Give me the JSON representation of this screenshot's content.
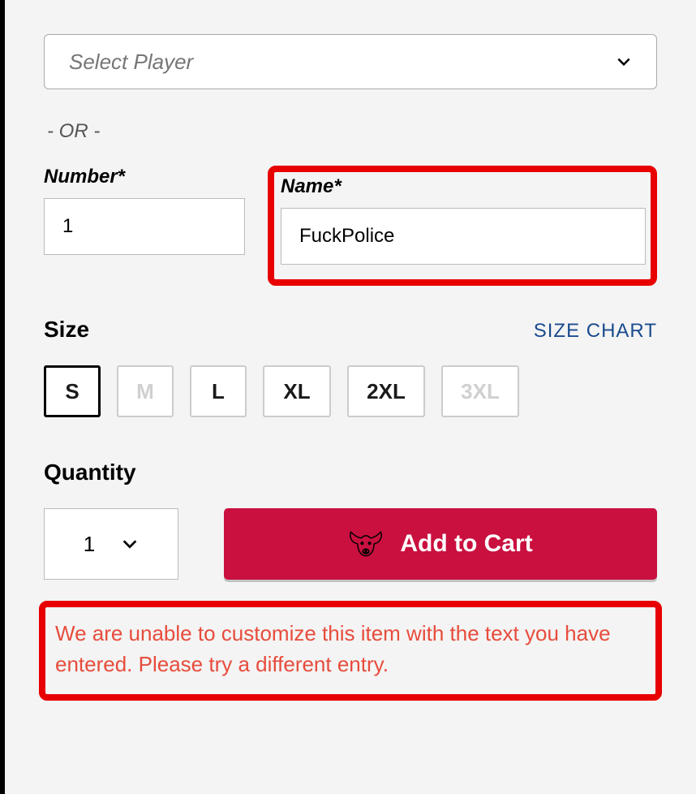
{
  "player_select": {
    "placeholder": "Select Player"
  },
  "divider": "- OR -",
  "number": {
    "label": "Number*",
    "value": "1"
  },
  "name": {
    "label": "Name*",
    "value": "FuckPolice"
  },
  "size": {
    "label": "Size",
    "chart_link": "SIZE CHART",
    "options": {
      "s": "S",
      "m": "M",
      "l": "L",
      "xl": "XL",
      "xxl": "2XL",
      "xxxl": "3XL"
    }
  },
  "quantity": {
    "label": "Quantity",
    "value": "1"
  },
  "add_to_cart_label": "Add to Cart",
  "error_message": "We are unable to customize this item with the text you have entered. Please try a different entry."
}
